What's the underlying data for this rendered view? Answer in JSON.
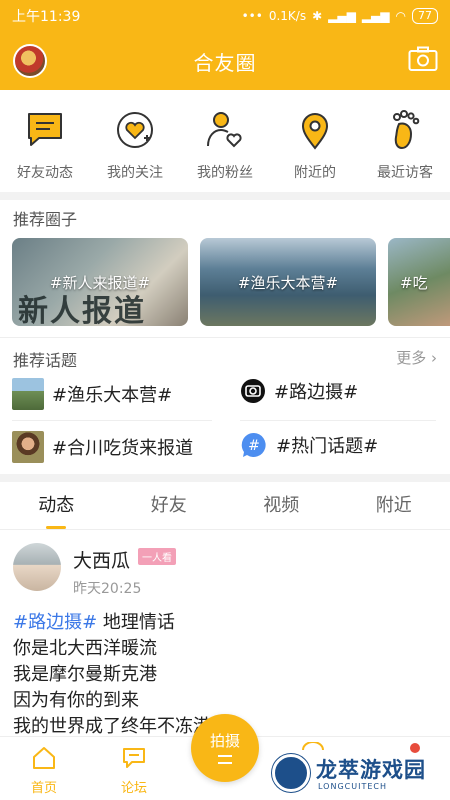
{
  "status": {
    "time": "上午11:39",
    "speed": "0.1K/s",
    "battery": "77"
  },
  "header": {
    "title": "合友圈"
  },
  "quick_nav": [
    {
      "label": "好友动态",
      "icon": "chat-bubble-icon"
    },
    {
      "label": "我的关注",
      "icon": "heart-plus-icon"
    },
    {
      "label": "我的粉丝",
      "icon": "person-heart-icon"
    },
    {
      "label": "附近的",
      "icon": "location-pin-icon"
    },
    {
      "label": "最近访客",
      "icon": "footprint-icon"
    }
  ],
  "recommend_circles": {
    "title": "推荐圈子",
    "items": [
      {
        "caption": "#新人来报道#",
        "overlay": "新人报道"
      },
      {
        "caption": "#渔乐大本营#"
      },
      {
        "caption": "#吃"
      }
    ]
  },
  "recommend_topics": {
    "title": "推荐话题",
    "more": "更多",
    "items": [
      {
        "label": "#渔乐大本营#"
      },
      {
        "label": "#路边摄#"
      },
      {
        "label": "#合川吃货来报道"
      },
      {
        "label": "#热门话题#"
      }
    ]
  },
  "feed_tabs": [
    {
      "label": "动态",
      "active": true
    },
    {
      "label": "好友"
    },
    {
      "label": "视频"
    },
    {
      "label": "附近"
    }
  ],
  "post": {
    "author": "大西瓜",
    "badge": "一人看",
    "time": "昨天20:25",
    "tag": "#路边摄#",
    "tag_suffix": "  地理情话",
    "lines": [
      "你是北大西洋暖流",
      "我是摩尔曼斯克港",
      "因为有你的到来",
      "我的世界成了终年不冻港❤"
    ]
  },
  "bottom_nav": {
    "home": "首页",
    "forum": "论坛",
    "shoot": "拍摄"
  },
  "watermark": {
    "name": "龙萃游戏园",
    "sub": "LONGCUITECH"
  },
  "colors": {
    "accent": "#F9B716",
    "tag": "#3b78e7",
    "badge": "#f3a0b7"
  }
}
